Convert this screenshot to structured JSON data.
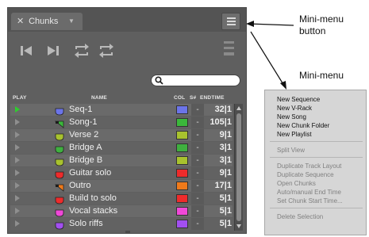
{
  "tab": {
    "label": "Chunks"
  },
  "search": {
    "value": "",
    "placeholder": ""
  },
  "columns": {
    "play": "PLAY",
    "name": "NAME",
    "col": "COL",
    "snum": "S#",
    "endtime": "ENDTIME"
  },
  "chunks": [
    {
      "name": "Seq-1",
      "type": "sequence",
      "color": "#6b74e8",
      "snum": "-",
      "end": "32|1",
      "playing": true
    },
    {
      "name": "Song-1",
      "type": "song",
      "color": "#3bb83b",
      "snum": "-",
      "end": "105|1",
      "playing": false
    },
    {
      "name": "Verse 2",
      "type": "vrack",
      "color": "#a8c22e",
      "snum": "-",
      "end": "9|1",
      "playing": false
    },
    {
      "name": "Bridge A",
      "type": "vrack",
      "color": "#3fb03f",
      "snum": "-",
      "end": "3|1",
      "playing": false
    },
    {
      "name": "Bridge B",
      "type": "vrack",
      "color": "#a8c22e",
      "snum": "-",
      "end": "3|1",
      "playing": false
    },
    {
      "name": "Guitar solo",
      "type": "vrack",
      "color": "#ee2b2b",
      "snum": "-",
      "end": "9|1",
      "playing": false
    },
    {
      "name": "Outro",
      "type": "song",
      "color": "#f07a1a",
      "snum": "-",
      "end": "17|1",
      "playing": false
    },
    {
      "name": "Build to solo",
      "type": "vrack",
      "color": "#ee2b2b",
      "snum": "-",
      "end": "5|1",
      "playing": false
    },
    {
      "name": "Vocal stacks",
      "type": "vrack",
      "color": "#f048d8",
      "snum": "-",
      "end": "5|1",
      "playing": false
    },
    {
      "name": "Solo riffs",
      "type": "vrack",
      "color": "#a24ff0",
      "snum": "-",
      "end": "5|1",
      "playing": false
    }
  ],
  "callouts": {
    "menu_button_line1": "Mini-menu",
    "menu_button_line2": "button",
    "mini_menu": "Mini-menu"
  },
  "mini_menu": {
    "group1": [
      "New Sequence",
      "New V-Rack",
      "New Song",
      "New Chunk Folder",
      "New Playlist"
    ],
    "group2": [
      "Split View"
    ],
    "group3": [
      "Duplicate Track Layout",
      "Duplicate Sequence",
      "Open Chunks",
      "Auto/manual End Time",
      "Set Chunk Start Time..."
    ],
    "group4": [
      "Delete Selection"
    ]
  },
  "icons": {
    "tab_close": "close-icon",
    "tab_dropdown": "chevron-down-icon",
    "menu": "hamburger-icon",
    "skip_back": "skip-back-icon",
    "play_skip": "skip-forward-icon",
    "loop_1": "loop-icon",
    "loop_2": "loop-icon",
    "list_view": "list-view-icon",
    "search": "search-icon"
  },
  "colors": {
    "panel_bg": "#5f5f5f",
    "playing_indicator": "#2fcc2f",
    "accent_text": "#f0f0f0"
  }
}
